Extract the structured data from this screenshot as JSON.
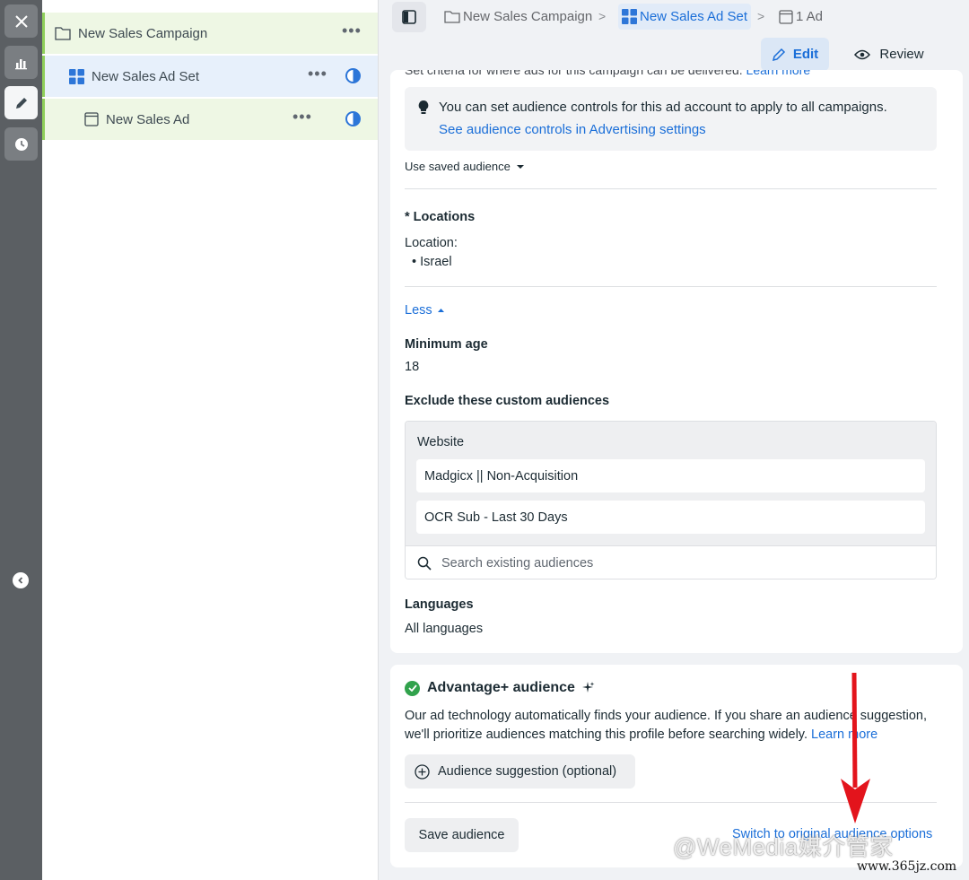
{
  "tree": {
    "campaign": "New Sales Campaign",
    "adset": "New Sales Ad Set",
    "ad": "New Sales Ad",
    "more": "•••"
  },
  "breadcrumb": {
    "campaign": "New Sales Campaign",
    "adset": "New Sales Ad Set",
    "ad": "1 Ad",
    "separator": ">"
  },
  "toolbar": {
    "edit": "Edit",
    "review": "Review"
  },
  "audience": {
    "cut_text": "Set criteria for where ads for this campaign can be delivered.",
    "cut_link": "Learn more",
    "info_text": "You can set audience controls for this ad account to apply to all campaigns.",
    "info_link": "See audience controls in Advertising settings",
    "saved_audience": "Use saved audience",
    "locations_heading": "* Locations",
    "location_label": "Location:",
    "location_item": "Israel",
    "less": "Less",
    "min_age_heading": "Minimum age",
    "min_age_value": "18",
    "exclude_heading": "Exclude these custom audiences",
    "exclude_group": "Website",
    "excluded": [
      "Madgicx || Non-Acquisition",
      "OCR Sub - Last 30 Days"
    ],
    "search_placeholder": "Search existing audiences",
    "languages_heading": "Languages",
    "languages_value": "All languages"
  },
  "advantage": {
    "title": "Advantage+ audience",
    "desc": "Our ad technology automatically finds your audience. If you share an audience suggestion, we'll prioritize audiences matching this profile before searching widely.",
    "learn_more": "Learn more",
    "suggestion_button": "Audience suggestion (optional)",
    "save_button": "Save audience",
    "switch_link": "Switch to original audience options"
  },
  "watermark": {
    "text": "@WeMedia媒介管家",
    "url": "www.365jz.com"
  },
  "colors": {
    "accent": "#1a6ed8",
    "success": "#31a24c",
    "arrow": "#e3141c"
  }
}
